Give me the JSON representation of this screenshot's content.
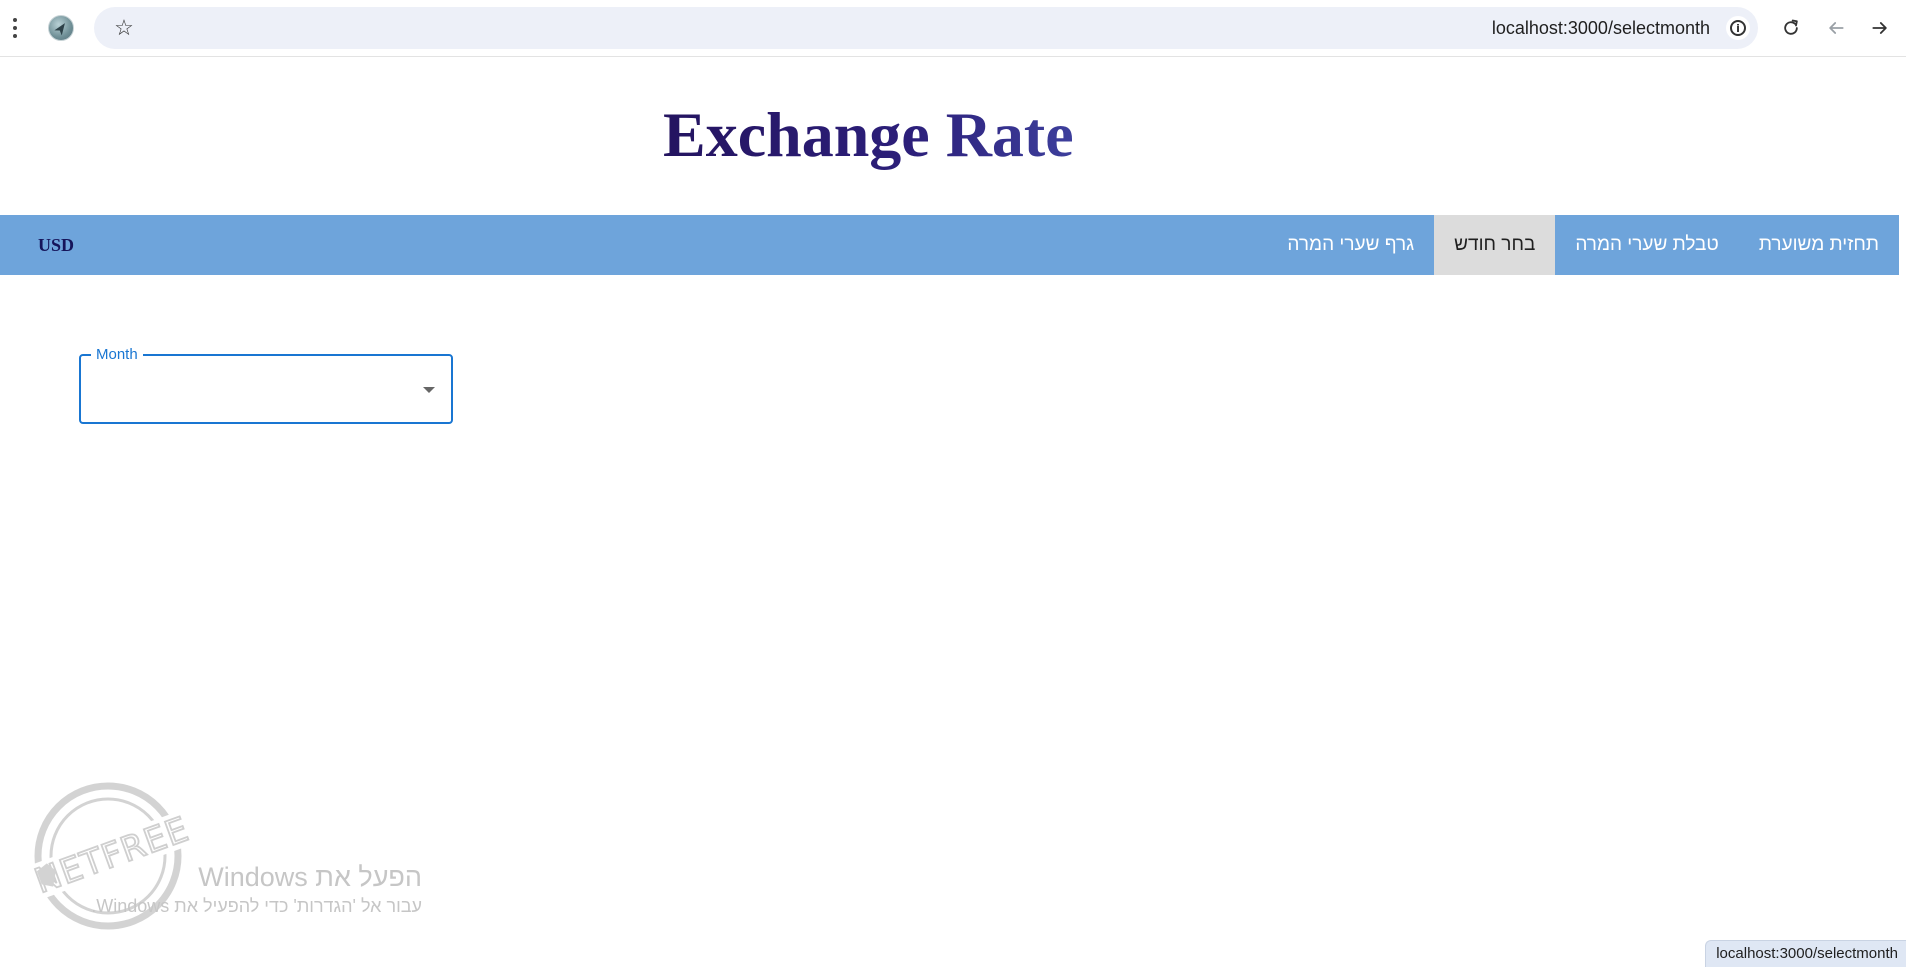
{
  "browser": {
    "url": "localhost:3000/selectmonth"
  },
  "page": {
    "title": "Exchange Rate"
  },
  "navbar": {
    "currency": "USD",
    "items": [
      {
        "label": "גרף שערי המרה",
        "active": false
      },
      {
        "label": "בחר חודש",
        "active": true
      },
      {
        "label": "טבלת שערי המרה",
        "active": false
      },
      {
        "label": "תחזית משוערת",
        "active": false
      }
    ]
  },
  "month_select": {
    "label": "Month",
    "value": ""
  },
  "watermark": {
    "activate_title": "הפעל את Windows",
    "activate_sub": "עבור אל 'הגדרות' כדי להפעיל את Windows."
  },
  "status_bar": {
    "url": "localhost:3000/selectmonth"
  },
  "colors": {
    "navbar": "#6ea4db",
    "active_tab": "#dcdcdc",
    "title": "#241460",
    "select_border": "#1976d2"
  }
}
